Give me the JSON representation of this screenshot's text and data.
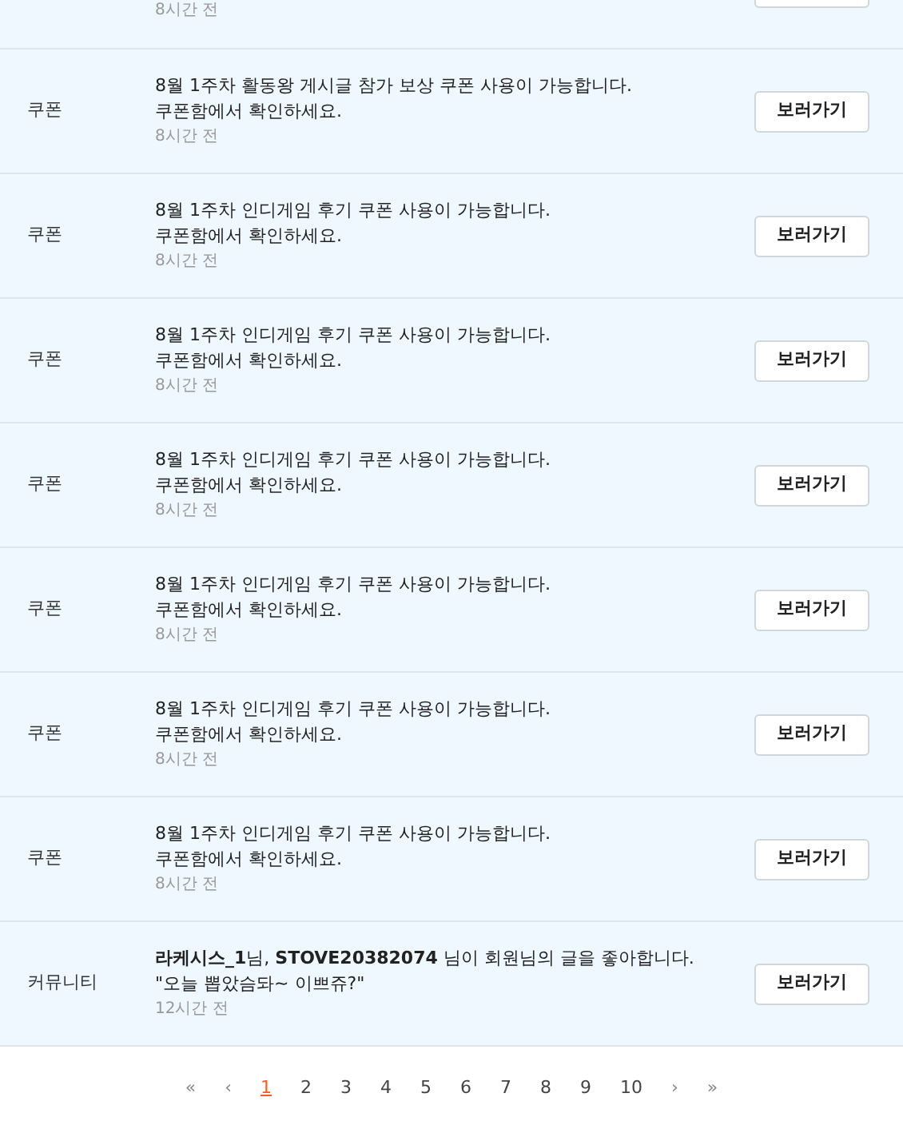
{
  "partial_row": {
    "time": "8시간 전"
  },
  "notifications": [
    {
      "category": "쿠폰",
      "lines": [
        "8월 1주차 활동왕 게시글 참가 보상 쿠폰 사용이 가능합니다.",
        "쿠폰함에서 확인하세요."
      ],
      "time": "8시간 전",
      "button": "보러가기"
    },
    {
      "category": "쿠폰",
      "lines": [
        "8월 1주차 인디게임 후기 쿠폰 사용이 가능합니다.",
        "쿠폰함에서 확인하세요."
      ],
      "time": "8시간 전",
      "button": "보러가기"
    },
    {
      "category": "쿠폰",
      "lines": [
        "8월 1주차 인디게임 후기 쿠폰 사용이 가능합니다.",
        "쿠폰함에서 확인하세요."
      ],
      "time": "8시간 전",
      "button": "보러가기"
    },
    {
      "category": "쿠폰",
      "lines": [
        "8월 1주차 인디게임 후기 쿠폰 사용이 가능합니다.",
        "쿠폰함에서 확인하세요."
      ],
      "time": "8시간 전",
      "button": "보러가기"
    },
    {
      "category": "쿠폰",
      "lines": [
        "8월 1주차 인디게임 후기 쿠폰 사용이 가능합니다.",
        "쿠폰함에서 확인하세요."
      ],
      "time": "8시간 전",
      "button": "보러가기"
    },
    {
      "category": "쿠폰",
      "lines": [
        "8월 1주차 인디게임 후기 쿠폰 사용이 가능합니다.",
        "쿠폰함에서 확인하세요."
      ],
      "time": "8시간 전",
      "button": "보러가기"
    },
    {
      "category": "쿠폰",
      "lines": [
        "8월 1주차 인디게임 후기 쿠폰 사용이 가능합니다.",
        "쿠폰함에서 확인하세요."
      ],
      "time": "8시간 전",
      "button": "보러가기"
    },
    {
      "category": "커뮤니티",
      "lines": [
        "**라케시스_1**님, **STOVE20382074** 님이 회원님의 글을 좋아합니다.",
        "\"오늘 뽑았슴돠~ 이쁘쥬?\""
      ],
      "time": "12시간 전",
      "button": "보러가기"
    }
  ],
  "pagination": [
    {
      "label": "«",
      "kind": "nav",
      "selected": false
    },
    {
      "label": "‹",
      "kind": "nav",
      "selected": false
    },
    {
      "label": "1",
      "kind": "page",
      "selected": true
    },
    {
      "label": "2",
      "kind": "page",
      "selected": false
    },
    {
      "label": "3",
      "kind": "page",
      "selected": false
    },
    {
      "label": "4",
      "kind": "page",
      "selected": false
    },
    {
      "label": "5",
      "kind": "page",
      "selected": false
    },
    {
      "label": "6",
      "kind": "page",
      "selected": false
    },
    {
      "label": "7",
      "kind": "page",
      "selected": false
    },
    {
      "label": "8",
      "kind": "page",
      "selected": false
    },
    {
      "label": "9",
      "kind": "page",
      "selected": false
    },
    {
      "label": "10",
      "kind": "page",
      "selected": false
    },
    {
      "label": "›",
      "kind": "nav",
      "selected": false
    },
    {
      "label": "»",
      "kind": "nav",
      "selected": false
    }
  ]
}
